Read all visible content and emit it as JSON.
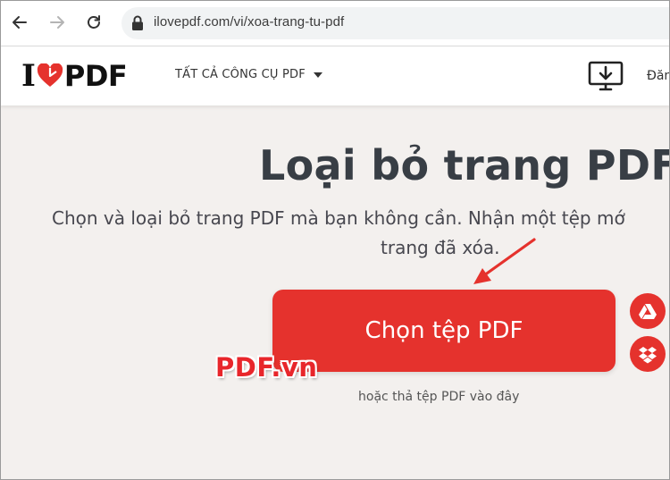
{
  "browser": {
    "url": "ilovepdf.com/vi/xoa-trang-tu-pdf"
  },
  "header": {
    "logo_i": "I",
    "logo_pdf": "PDF",
    "tools_menu": "TẤT CẢ CÔNG CỤ PDF",
    "login": "Đăn"
  },
  "main": {
    "title": "Loại bỏ trang PDF",
    "subtitle_line1": "Chọn và loại bỏ trang PDF mà bạn không cần. Nhận một tệp mớ",
    "subtitle_line2": "trang đã xóa.",
    "select_button": "Chọn tệp PDF",
    "drop_hint": "hoặc thả tệp PDF vào đây"
  },
  "overlay": {
    "watermark": "PDF.vn"
  },
  "colors": {
    "brand_red": "#e5322d",
    "background": "#f3f0ee"
  }
}
